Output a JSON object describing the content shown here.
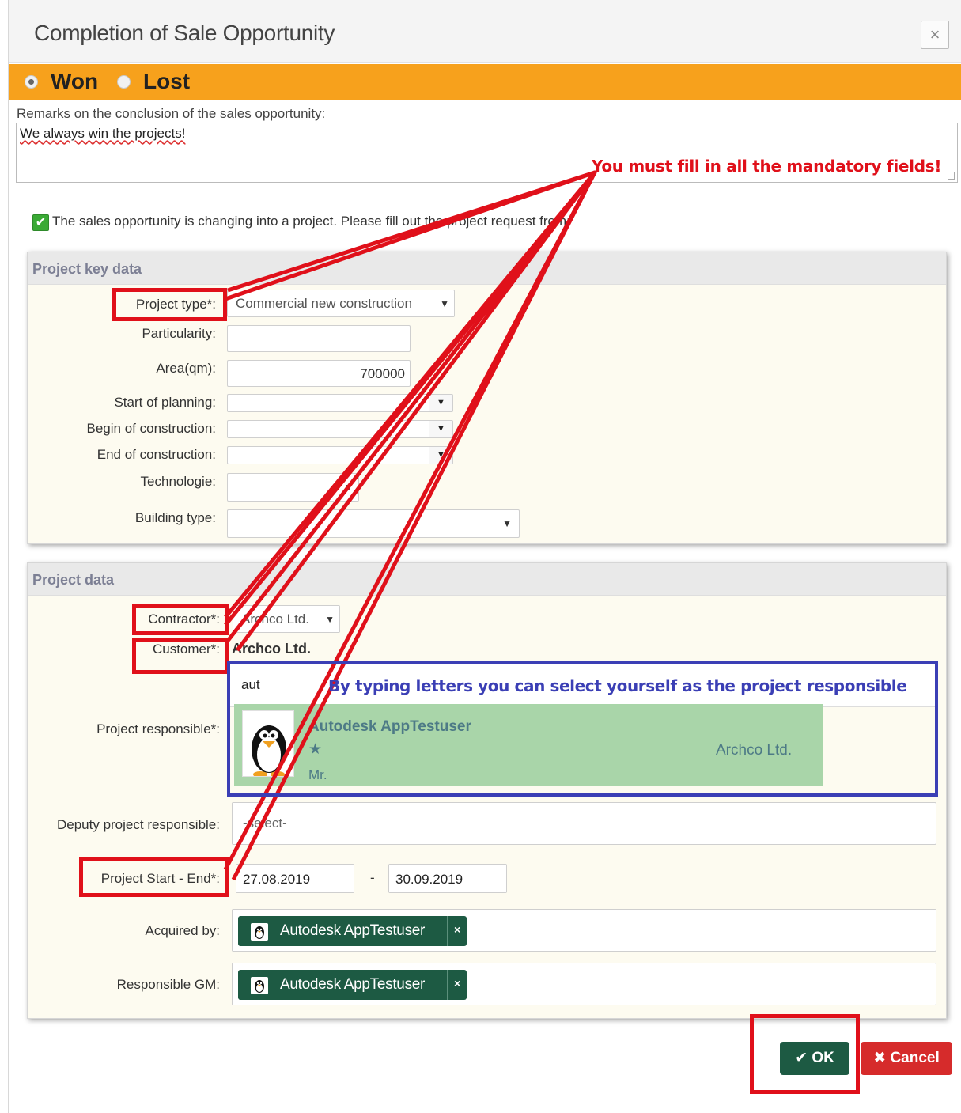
{
  "dialog": {
    "title": "Completion of Sale Opportunity",
    "close_label": "×"
  },
  "status": {
    "won_label": "Won",
    "lost_label": "Lost",
    "selected": "Won"
  },
  "remarks": {
    "label": "Remarks on the conclusion of the sales opportunity:",
    "value": "We always win the projects!"
  },
  "annotations": {
    "mandatory_note": "You must fill in all the mandatory fields!",
    "typing_note": "By typing letters you can select yourself as the project responsible"
  },
  "project_note": "The sales opportunity is changing into a project. Please fill out the project request from:",
  "key_data": {
    "heading": "Project key data",
    "project_type_label": "Project type*:",
    "project_type_value": "Commercial new construction",
    "particularity_label": "Particularity:",
    "particularity_value": "",
    "area_label": "Area(qm):",
    "area_value": "700000",
    "start_planning_label": "Start of planning:",
    "begin_construction_label": "Begin of construction:",
    "end_construction_label": "End of construction:",
    "technologie_label": "Technologie:",
    "building_type_label": "Building type:"
  },
  "project_data": {
    "heading": "Project data",
    "contractor_label": "Contractor*:",
    "contractor_value": "Archco Ltd.",
    "customer_label": "Customer*:",
    "customer_value": "Archco Ltd.",
    "responsible_label": "Project responsible*:",
    "responsible_search": "aut",
    "result": {
      "name": "Autodesk AppTestuser",
      "salutation": "Mr.",
      "company": "Archco Ltd."
    },
    "deputy_label": "Deputy project responsible:",
    "deputy_placeholder": "-select-",
    "start_end_label": "Project Start - End*:",
    "start_date": "27.08.2019",
    "range_separator": "-",
    "end_date": "30.09.2019",
    "acquired_label": "Acquired by:",
    "acquired_value": "Autodesk AppTestuser",
    "gm_label": "Responsible GM:",
    "gm_value": "Autodesk AppTestuser"
  },
  "buttons": {
    "ok_label": "OK",
    "cancel_label": "Cancel"
  },
  "colors": {
    "status_bar": "#f7a11c",
    "annotation_red": "#e0101a",
    "annotation_blue": "#3b3fb5",
    "ok_button": "#1d5a43",
    "cancel_button": "#d62b2b",
    "result_highlight": "#a9d5a9"
  }
}
